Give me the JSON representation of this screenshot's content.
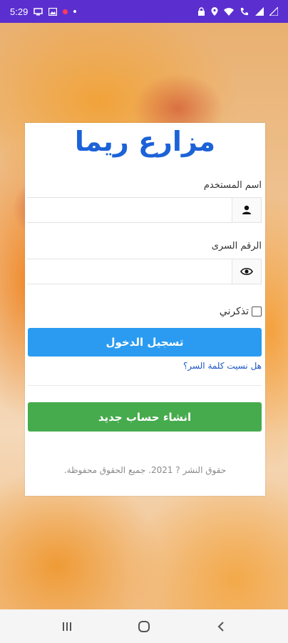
{
  "status_bar": {
    "time": "5:29",
    "left_icons": [
      "monitor-icon",
      "image-icon",
      "record-icon",
      "dot-icon"
    ],
    "right_icons": [
      "lock-icon",
      "location-icon",
      "wifi-icon",
      "wifi-call-icon",
      "signal-icon",
      "signal-icon-2"
    ]
  },
  "login": {
    "app_title": "مزارع ريما",
    "username_label": "اسم المستخدم",
    "username_value": "",
    "username_icon": "user-icon",
    "password_label": "الرقم السرى",
    "password_value": "",
    "password_icon": "eye-icon",
    "remember_label": "تذكرني",
    "remember_checked": false,
    "login_button": "تسجيل الدخول",
    "forgot_link": "هل نسيت كلمة السر؟",
    "register_button": "انشاء حساب جديد",
    "copyright": "حقوق النشر ? 2021. جميع الحقوق محفوظة."
  },
  "nav_bar": {
    "buttons": [
      "recent-apps-icon",
      "home-icon",
      "back-icon"
    ]
  },
  "colors": {
    "status_bar": "#5b2fcf",
    "title": "#1c62d8",
    "login_button": "#2a9bf0",
    "register_button": "#46ab4d",
    "link": "#1a56c4"
  }
}
